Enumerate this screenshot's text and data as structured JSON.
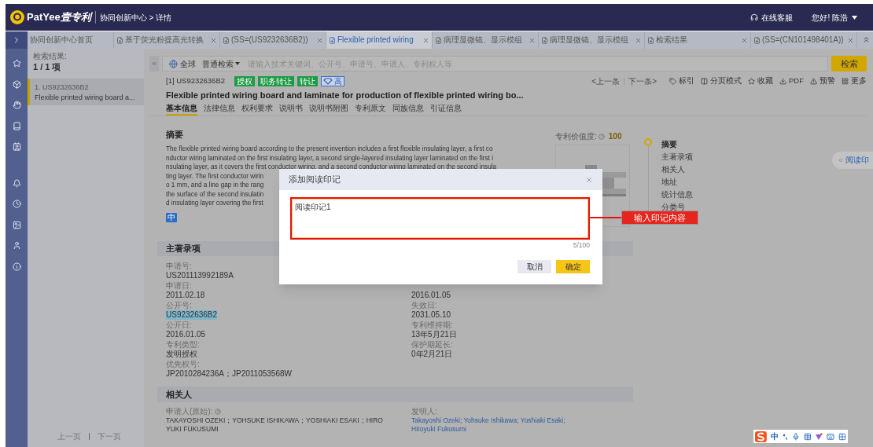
{
  "header": {
    "brand": "PatYee",
    "brand_cn": "壹专利",
    "breadcrumb": "协同创新中心 > 详情",
    "support": "在线客服",
    "user": "您好! 陈浩"
  },
  "tabs": [
    {
      "label": "协同创新中心首页",
      "closable": false,
      "selected": false
    },
    {
      "label": "基于荧光粉提高光转换",
      "closable": true,
      "selected": false
    },
    {
      "label": "(SS=(US9232636B2))",
      "closable": true,
      "selected": false
    },
    {
      "label": "Flexible printed wiring",
      "closable": true,
      "selected": true
    },
    {
      "label": "病理显微镜、显示模组",
      "closable": true,
      "selected": false
    },
    {
      "label": "病理显微镜、显示模组",
      "closable": true,
      "selected": false
    },
    {
      "label": "检索结果",
      "closable": true,
      "selected": false
    },
    {
      "label": "(SS=(CN101498401A))",
      "closable": true,
      "selected": false
    }
  ],
  "search": {
    "scope": "全球",
    "mode": "普通检索",
    "placeholder": "请输入技术关键词、公开号、申请号、申请人、专利权人等",
    "button": "检索"
  },
  "results": {
    "label": "检索结果:",
    "count": "1 / 1 项",
    "items": [
      {
        "number": "1. US9232636B2",
        "title": "Flexible printed wiring board a...",
        "selected": true
      }
    ],
    "prev": "上一页",
    "next": "下一页"
  },
  "detail": {
    "index": "[1] US9232636B2",
    "tags": [
      {
        "label": "授权",
        "kind": "status"
      },
      {
        "label": "职务转让",
        "kind": "status"
      },
      {
        "label": "转让",
        "kind": "status"
      },
      {
        "label": "高",
        "kind": "rating"
      }
    ],
    "title": "Flexible printed wiring board and laminate for production of flexible printed wiring bo...",
    "prev": "<上一条",
    "next": "下一条>",
    "actions": [
      "标引",
      "分页模式",
      "收藏",
      "PDF",
      "预警",
      "更多"
    ]
  },
  "subtabs": [
    {
      "label": "基本信息",
      "selected": true
    },
    {
      "label": "法律信息",
      "selected": false
    },
    {
      "label": "权利要求",
      "selected": false
    },
    {
      "label": "说明书",
      "selected": false
    },
    {
      "label": "说明书附图",
      "selected": false
    },
    {
      "label": "专利原文",
      "selected": false
    },
    {
      "label": "同族信息",
      "selected": false
    },
    {
      "label": "引证信息",
      "selected": false
    }
  ],
  "abstract": {
    "heading": "摘要",
    "lines": [
      "The flexible printed wiring board according to the present invention includes a first flexible insulating layer, a first co",
      "nductor wiring laminated on the first insulating layer, a second single-layered insulating layer laminated on the first i",
      "nsulating layer, as it covers the first conductor wiring, and a second conductor wiring laminated on the second insula",
      "ting layer. The first conductor wirin",
      "o 1 mm, and a line gap in the rang",
      "the surface of the second insulatin",
      "d insulating layer covering the first"
    ],
    "translate": "中"
  },
  "value": {
    "label": "专利价值度:",
    "score": "100"
  },
  "outline": [
    {
      "label": "摘要",
      "selected": true
    },
    {
      "label": "主著录项",
      "selected": false
    },
    {
      "label": "相关人",
      "selected": false
    },
    {
      "label": "地址",
      "selected": false
    },
    {
      "label": "统计信息",
      "selected": false
    },
    {
      "label": "分类号",
      "selected": false
    }
  ],
  "biblio": {
    "heading": "主著录项",
    "left": [
      {
        "label": "申请号:",
        "value": "US201113992189A",
        "highlighted": false
      },
      {
        "label": "申请日:",
        "value": "2011.02.18",
        "highlighted": false
      },
      {
        "label": "公开号:",
        "value": "US9232636B2",
        "highlighted": true
      },
      {
        "label": "公开日:",
        "value": "2016.01.05",
        "highlighted": false
      },
      {
        "label": "专利类型:",
        "value": "发明授权",
        "highlighted": false
      },
      {
        "label": "优先权号:",
        "value": "JP2010284236A；JP2011053568W",
        "highlighted": false
      }
    ],
    "right": [
      {
        "value": "2016.01.05",
        "highlighted": false
      },
      {
        "label": "失效日:",
        "value": "2031.05.10",
        "highlighted": false
      },
      {
        "label": "专利维持期:",
        "value": "13年5月21日",
        "highlighted": false
      },
      {
        "label": "保护期延长:",
        "value": "0年2月21日",
        "highlighted": false
      }
    ]
  },
  "parties": {
    "heading": "相关人",
    "applicant_label": "申请人(原始):",
    "applicant": "TAKAYOSHI OZEKI；YOHSUKE ISHIKAWA；YOSHIAKI ESAKI；HIROYUKI FUKUSUMI",
    "inventor_label": "发明人:",
    "inventor": "Takayoshi Ozeki; Yohsuke Ishikawa; Yoshiaki Esaki; Hiroyuki Fukusumi"
  },
  "side_tab": "阅读印",
  "dialog": {
    "title": "添加阅读印记",
    "value": "阅读印记1",
    "counter": "5/100",
    "cancel": "取消",
    "confirm": "确定"
  },
  "annotation": {
    "label": "输入印记内容"
  },
  "ime": {
    "mode": "中"
  }
}
